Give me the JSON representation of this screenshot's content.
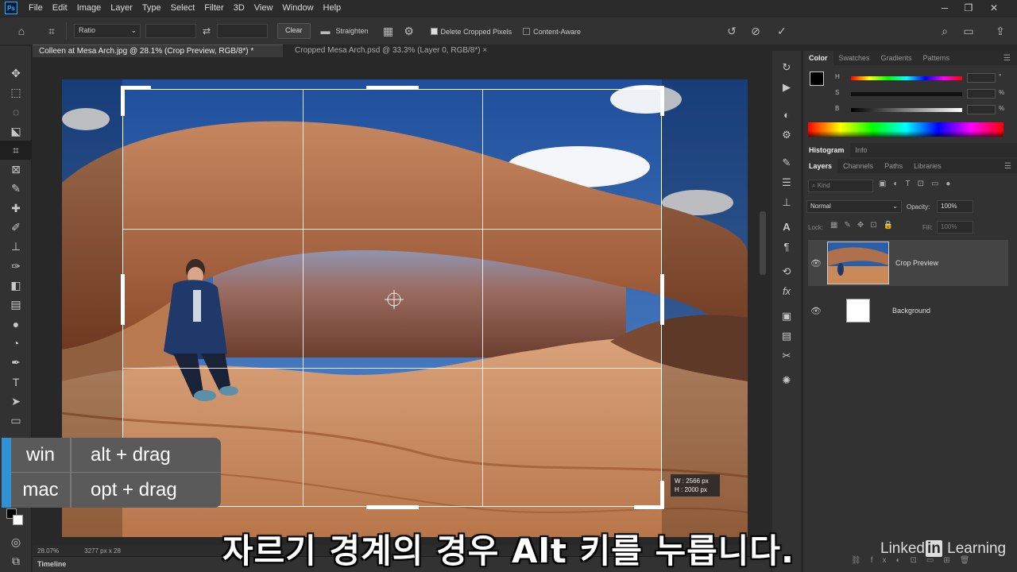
{
  "app": {
    "logo_text": "Ps"
  },
  "menu": [
    "File",
    "Edit",
    "Image",
    "Layer",
    "Type",
    "Select",
    "Filter",
    "3D",
    "View",
    "Window",
    "Help"
  ],
  "window_controls": {
    "minimize": "─",
    "restore": "❐",
    "close": "✕"
  },
  "options": {
    "ratio_label": "Ratio",
    "clear_label": "Clear",
    "straighten_label": "Straighten",
    "delete_cropped_label": "Delete Cropped Pixels",
    "delete_cropped_checked": true,
    "content_aware_label": "Content-Aware",
    "content_aware_checked": false
  },
  "doc_tabs": [
    {
      "title": "Colleen at Mesa Arch.jpg @ 28.1% (Crop Preview, RGB/8*) *",
      "active": true
    },
    {
      "title": "Cropped Mesa Arch.psd @ 33.3% (Layer 0, RGB/8*)",
      "active": false
    }
  ],
  "crop_readout": {
    "w": "W :  2566 px",
    "h": "H :  2000 px"
  },
  "status": {
    "zoom": "28.07%",
    "doc_size": "3277 px x 28"
  },
  "timeline_label": "Timeline",
  "panels": {
    "color_tabs": [
      "Color",
      "Swatches",
      "Gradients",
      "Patterns"
    ],
    "hsb_labels": [
      "H",
      "S",
      "B"
    ],
    "hsb_units": [
      "°",
      "%",
      "%"
    ],
    "mid_tabs": [
      "Histogram",
      "Info"
    ],
    "layer_tabs": [
      "Layers",
      "Channels",
      "Paths",
      "Libraries"
    ],
    "kind_placeholder": "Kind",
    "blend_mode": "Normal",
    "opacity_label": "Opacity:",
    "opacity_value": "100%",
    "lock_label": "Lock:",
    "fill_label": "Fill:",
    "fill_value": "100%",
    "layers": [
      {
        "name": "Crop Preview",
        "selected": true
      },
      {
        "name": "Background",
        "selected": false
      }
    ]
  },
  "shortcut": {
    "win_key": "win",
    "win_action": "alt + drag",
    "mac_key": "mac",
    "mac_action": "opt + drag"
  },
  "subtitle": "자르기 경계의 경우 Alt 키를 누릅니다.",
  "watermark": {
    "prefix": "Linked",
    "in": "in",
    "suffix": " Learning"
  },
  "colors": {
    "accent_blue": "#2f93d3",
    "panel_bg": "#323232",
    "canvas_sky": "#2a5fa8",
    "rock": "#c98a58"
  }
}
